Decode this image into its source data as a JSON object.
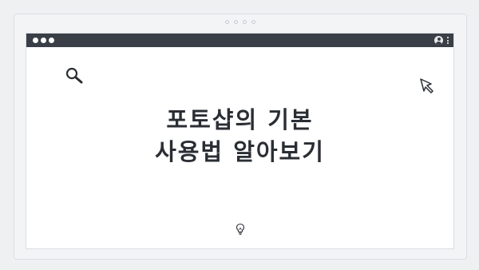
{
  "headline": {
    "line1": "포토샵의 기본",
    "line2": "사용법 알아보기"
  },
  "icons": {
    "search": "search-icon",
    "cursor": "cursor-icon",
    "bulb": "lightbulb-icon",
    "user": "user-icon",
    "menu": "kebab-menu-icon"
  },
  "colors": {
    "titlebar": "#3a3f47",
    "page_background": "#eef0f2",
    "window_background": "#ffffff",
    "text": "#2a2e34"
  }
}
